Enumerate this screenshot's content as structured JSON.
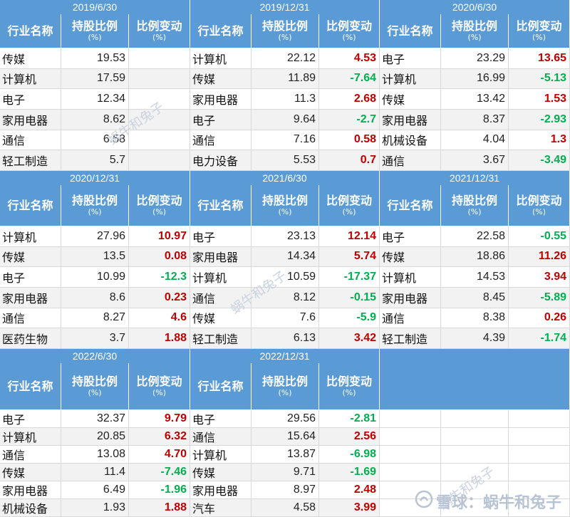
{
  "headers": {
    "industry": "行业名称",
    "holding": "持股比例",
    "holding_unit": "(%)",
    "change": "比例变动",
    "change_unit": "(%)"
  },
  "colors": {
    "header": "#5b9bd5",
    "up": "#c00000",
    "down": "#00b050"
  },
  "panels": [
    {
      "date": "2019/6/30",
      "rows": [
        {
          "name": "传媒",
          "holding": "19.53",
          "change": ""
        },
        {
          "name": "计算机",
          "holding": "17.59",
          "change": ""
        },
        {
          "name": "电子",
          "holding": "12.34",
          "change": ""
        },
        {
          "name": "家用电器",
          "holding": "8.62",
          "change": ""
        },
        {
          "name": "通信",
          "holding": "6.58",
          "change": ""
        },
        {
          "name": "轻工制造",
          "holding": "5.7",
          "change": ""
        }
      ]
    },
    {
      "date": "2019/12/31",
      "rows": [
        {
          "name": "计算机",
          "holding": "22.12",
          "change": "4.53"
        },
        {
          "name": "传媒",
          "holding": "11.89",
          "change": "-7.64"
        },
        {
          "name": "家用电器",
          "holding": "11.3",
          "change": "2.68"
        },
        {
          "name": "电子",
          "holding": "9.64",
          "change": "-2.7"
        },
        {
          "name": "通信",
          "holding": "7.16",
          "change": "0.58"
        },
        {
          "name": "电力设备",
          "holding": "5.53",
          "change": "0.7"
        }
      ]
    },
    {
      "date": "2020/6/30",
      "rows": [
        {
          "name": "电子",
          "holding": "23.29",
          "change": "13.65"
        },
        {
          "name": "计算机",
          "holding": "16.99",
          "change": "-5.13"
        },
        {
          "name": "传媒",
          "holding": "13.42",
          "change": "1.53"
        },
        {
          "name": "家用电器",
          "holding": "8.37",
          "change": "-2.93"
        },
        {
          "name": "机械设备",
          "holding": "4.04",
          "change": "1.3"
        },
        {
          "name": "通信",
          "holding": "3.67",
          "change": "-3.49"
        }
      ]
    },
    {
      "date": "2020/12/31",
      "rows": [
        {
          "name": "计算机",
          "holding": "27.96",
          "change": "10.97"
        },
        {
          "name": "传媒",
          "holding": "13.5",
          "change": "0.08"
        },
        {
          "name": "电子",
          "holding": "10.99",
          "change": "-12.3"
        },
        {
          "name": "家用电器",
          "holding": "8.6",
          "change": "0.23"
        },
        {
          "name": "通信",
          "holding": "8.27",
          "change": "4.6"
        },
        {
          "name": "医药生物",
          "holding": "3.7",
          "change": "1.88"
        }
      ]
    },
    {
      "date": "2021/6/30",
      "rows": [
        {
          "name": "电子",
          "holding": "23.13",
          "change": "12.14"
        },
        {
          "name": "家用电器",
          "holding": "14.34",
          "change": "5.74"
        },
        {
          "name": "计算机",
          "holding": "10.59",
          "change": "-17.37"
        },
        {
          "name": "通信",
          "holding": "8.12",
          "change": "-0.15"
        },
        {
          "name": "传媒",
          "holding": "7.6",
          "change": "-5.9"
        },
        {
          "name": "轻工制造",
          "holding": "6.13",
          "change": "3.42"
        }
      ]
    },
    {
      "date": "2021/12/31",
      "rows": [
        {
          "name": "电子",
          "holding": "22.58",
          "change": "-0.55"
        },
        {
          "name": "传媒",
          "holding": "18.86",
          "change": "11.26"
        },
        {
          "name": "计算机",
          "holding": "14.53",
          "change": "3.94"
        },
        {
          "name": "家用电器",
          "holding": "8.45",
          "change": "-5.89"
        },
        {
          "name": "通信",
          "holding": "8.38",
          "change": "0.26"
        },
        {
          "name": "轻工制造",
          "holding": "4.39",
          "change": "-1.74"
        }
      ]
    },
    {
      "date": "2022/6/30",
      "rows": [
        {
          "name": "电子",
          "holding": "32.37",
          "change": "9.79"
        },
        {
          "name": "计算机",
          "holding": "20.85",
          "change": "6.32"
        },
        {
          "name": "通信",
          "holding": "13.08",
          "change": "4.70"
        },
        {
          "name": "传媒",
          "holding": "11.4",
          "change": "-7.46"
        },
        {
          "name": "家用电器",
          "holding": "6.49",
          "change": "-1.96"
        },
        {
          "name": "机械设备",
          "holding": "1.93",
          "change": "1.88"
        }
      ]
    },
    {
      "date": "2022/12/31",
      "rows": [
        {
          "name": "电子",
          "holding": "29.56",
          "change": "-2.81"
        },
        {
          "name": "通信",
          "holding": "15.64",
          "change": "2.56"
        },
        {
          "name": "计算机",
          "holding": "13.87",
          "change": "-6.98"
        },
        {
          "name": "传媒",
          "holding": "9.71",
          "change": "-1.69"
        },
        {
          "name": "家用电器",
          "holding": "8.97",
          "change": "2.48"
        },
        {
          "name": "汽车",
          "holding": "4.58",
          "change": "3.99"
        }
      ]
    }
  ],
  "watermarks": [
    "蜗牛和兔子",
    "蜗牛和兔子",
    "蜗牛和兔子"
  ],
  "logo_text": "雪球：蜗牛和兔子"
}
